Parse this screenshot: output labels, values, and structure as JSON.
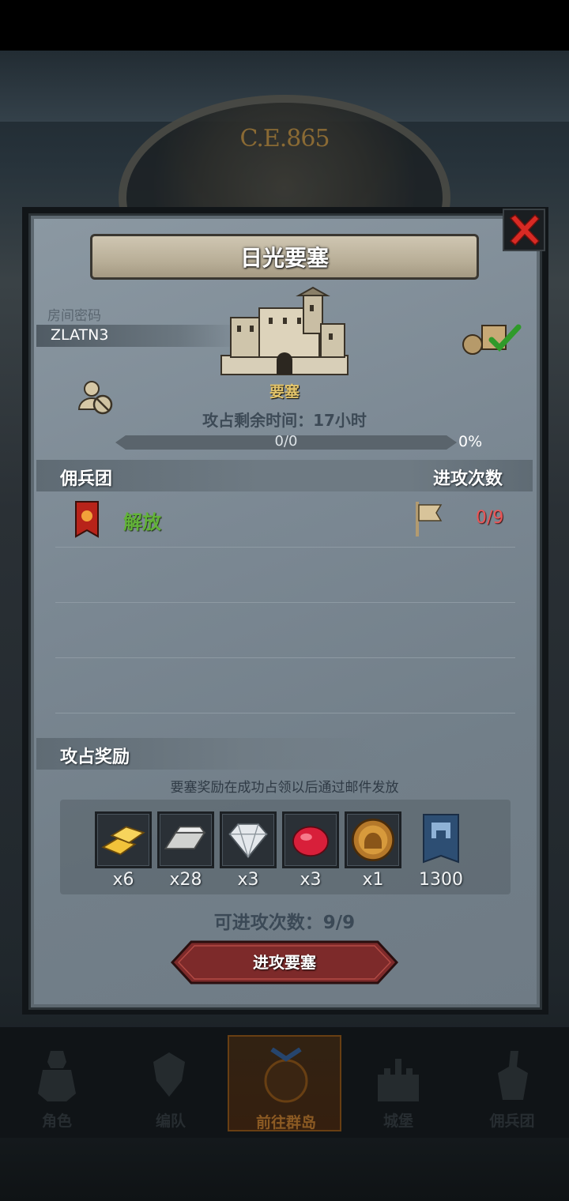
{
  "background": {
    "year_text": "C.E.865"
  },
  "dialog": {
    "title": "日光要塞",
    "room_label": "房间密码",
    "room_code": "ZLATN3",
    "fortress_name": "要塞",
    "time_remaining": "攻占剩余时间：17小时",
    "progress": {
      "text": "0/0",
      "percent_text": "0%",
      "fill": 0.0
    },
    "mercenary_header": "佣兵团",
    "attack_count_header": "进攻次数",
    "team": {
      "name": "解放",
      "attacks": "0/9",
      "banner_color": "#b8231a",
      "name_color": "#62b239"
    },
    "reward_header": "攻占奖励",
    "reward_note": "要塞奖励在成功占领以后通过邮件发放",
    "rewards": [
      {
        "icon": "gold-bars-icon",
        "qty": "x6"
      },
      {
        "icon": "iron-ingot-icon",
        "qty": "x28"
      },
      {
        "icon": "diamond-icon",
        "qty": "x3"
      },
      {
        "icon": "ruby-icon",
        "qty": "x3"
      },
      {
        "icon": "helmet-medal-icon",
        "qty": "x1"
      },
      {
        "icon": "fortress-banner-icon",
        "qty": "1300"
      }
    ],
    "remaining_attacks": "可进攻次数：9/9",
    "attack_button": "进攻要塞"
  },
  "nav": [
    {
      "label": "角色",
      "icon": "knight-icon"
    },
    {
      "label": "编队",
      "icon": "formation-icon"
    },
    {
      "label": "前往群岛",
      "icon": "compass-icon",
      "active": true
    },
    {
      "label": "城堡",
      "icon": "castle-icon"
    },
    {
      "label": "佣兵团",
      "icon": "mercenary-icon"
    }
  ],
  "colors": {
    "accent_green": "#62b239",
    "alert_red": "#ea5657",
    "gold": "#e3c46a"
  }
}
